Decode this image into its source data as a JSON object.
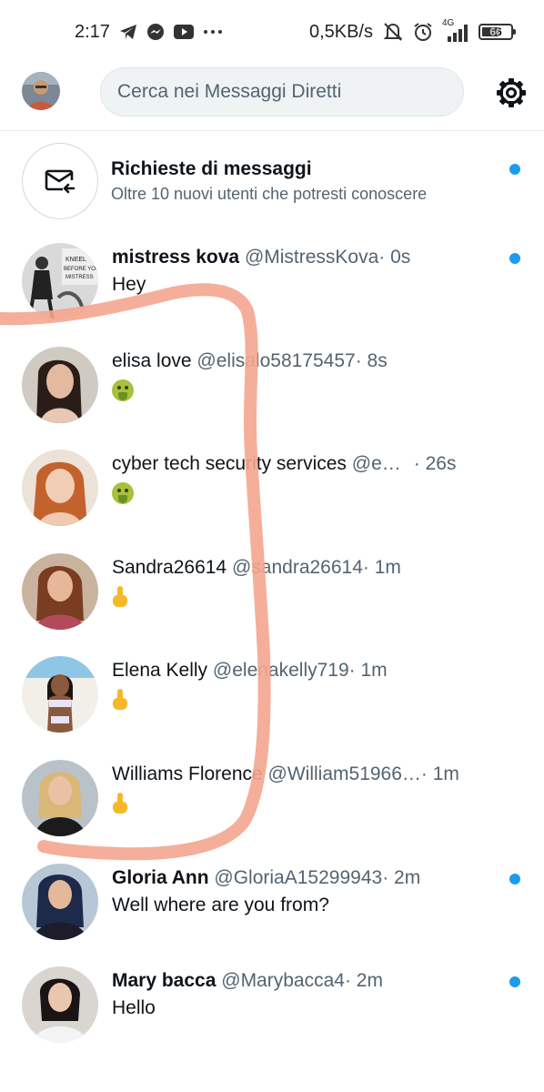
{
  "status_bar": {
    "time": "2:17",
    "speed": "0,5KB/s",
    "network": "4G",
    "battery": "66",
    "icons": [
      "telegram-icon",
      "messenger-icon",
      "youtube-icon",
      "more-dots-icon",
      "mute-icon",
      "alarm-icon",
      "signal-icon",
      "battery-icon"
    ]
  },
  "header": {
    "search_placeholder": "Cerca nei Messaggi Diretti",
    "settings_icon": "gear-icon"
  },
  "requests": {
    "title": "Richieste di messaggi",
    "subtitle": "Oltre 10 nuovi utenti che potresti conoscere",
    "icon": "mail-incoming-icon",
    "unread": true
  },
  "conversations": [
    {
      "name": "mistress kova",
      "handle": "@MistressKova",
      "time": "· 0s",
      "preview": "Hey",
      "preview_kind": "text",
      "bold": true,
      "unread": true
    },
    {
      "name": "elisa love",
      "handle": "@elisalo58175457",
      "time": "· 8s",
      "preview": "",
      "preview_kind": "vomit-emoji",
      "bold": false,
      "unread": false
    },
    {
      "name": "cyber tech security services",
      "handle": "@e…",
      "time": "· 26s",
      "preview": "",
      "preview_kind": "vomit-emoji",
      "bold": false,
      "unread": false
    },
    {
      "name": "Sandra26614",
      "handle": "@sandra26614",
      "time": "· 1m",
      "preview": "",
      "preview_kind": "finger-emoji",
      "bold": false,
      "unread": false
    },
    {
      "name": "Elena Kelly",
      "handle": "@elenakelly719",
      "time": "· 1m",
      "preview": "",
      "preview_kind": "finger-emoji",
      "bold": false,
      "unread": false
    },
    {
      "name": "Williams Florence",
      "handle": "@William51966…",
      "time": "· 1m",
      "preview": "",
      "preview_kind": "finger-emoji",
      "bold": false,
      "unread": false
    },
    {
      "name": "Gloria Ann",
      "handle": "@GloriaA15299943",
      "time": "· 2m",
      "preview": "Well where are you from?",
      "preview_kind": "text",
      "bold": true,
      "unread": true
    },
    {
      "name": "Mary bacca",
      "handle": "@Marybacca4",
      "time": "· 2m",
      "preview": "Hello",
      "preview_kind": "text",
      "bold": true,
      "unread": true
    }
  ],
  "colors": {
    "accent": "#1d9bf0",
    "scribble": "#f4a58f",
    "secondary_text": "#536471"
  }
}
